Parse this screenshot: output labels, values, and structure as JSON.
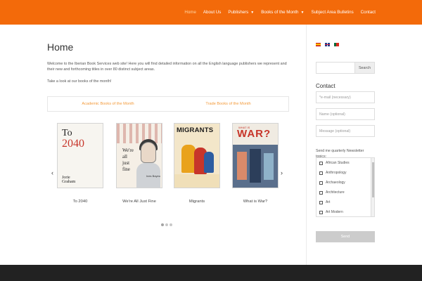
{
  "nav": {
    "items": [
      {
        "label": "Home",
        "active": true,
        "dropdown": false
      },
      {
        "label": "About Us",
        "active": false,
        "dropdown": false
      },
      {
        "label": "Publishers",
        "active": false,
        "dropdown": true
      },
      {
        "label": "Books of the Month",
        "active": false,
        "dropdown": true
      },
      {
        "label": "Subject Area Bulletins",
        "active": false,
        "dropdown": false
      },
      {
        "label": "Contact",
        "active": false,
        "dropdown": false
      }
    ]
  },
  "main": {
    "title": "Home",
    "intro": "Welcome to the Iberian Book Services web site! Here you will find detailed information on all the English language publishers we represent and their new and forthcoming titles in over 80 distinct subject areas.",
    "intro2": "Take a look at our books of the month!",
    "tabs": [
      {
        "label": "Academic Books of the Month"
      },
      {
        "label": "Trade Books of the Month"
      }
    ],
    "carousel": {
      "prev_icon": "chevron-left-icon",
      "next_icon": "chevron-right-icon",
      "books": [
        {
          "title": "To 2040",
          "cover": {
            "line1": "To",
            "line2": "2040",
            "author1": "Jorie",
            "author2": "Graham"
          }
        },
        {
          "title": "We're All Just Fine",
          "cover": {
            "line1": "We're",
            "line2": "all",
            "line3": "just",
            "line4": "fine",
            "author": "Ines Bayeu"
          }
        },
        {
          "title": "Migrants",
          "cover": {
            "line1": "MIGRANTS"
          }
        },
        {
          "title": "What is War?",
          "cover": {
            "line1": "WHAT IS",
            "line2": "WAR?"
          }
        }
      ],
      "pages": 3,
      "active_page": 0
    }
  },
  "sidebar": {
    "languages": [
      "es",
      "en",
      "pt"
    ],
    "search": {
      "placeholder": "",
      "button": "Search"
    },
    "contact": {
      "title": "Contact",
      "email_placeholder": "e-mail (necessary)",
      "name_placeholder": "Name (optional)",
      "message_placeholder": "Message (optional)",
      "newsletter_label": "Send me quarterly Newsletter topics:",
      "topics": [
        "African Studies",
        "Anthropology",
        "Archaeology",
        "Architecture",
        "Art",
        "Art Modern"
      ],
      "send_label": "Send"
    }
  },
  "colors": {
    "accent": "#f36a0a",
    "tab_text": "#f39a3a",
    "footer": "#222222"
  }
}
